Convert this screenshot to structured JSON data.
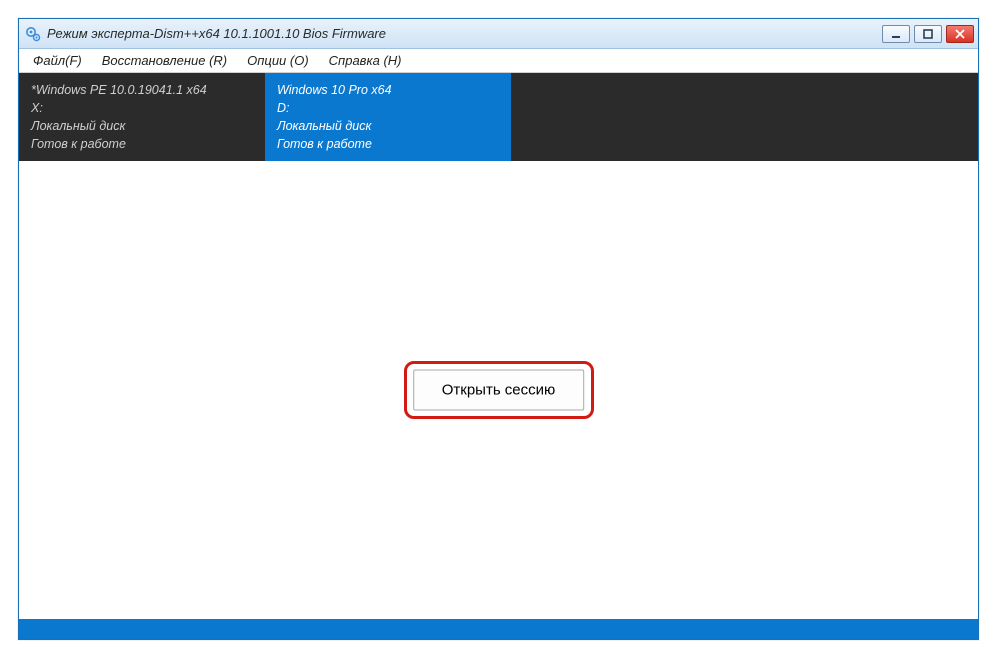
{
  "window": {
    "title": "Режим эксперта-Dism++x64 10.1.1001.10 Bios Firmware"
  },
  "menu": {
    "file": "Файл(F)",
    "restore": "Восстановление (R)",
    "options": "Опции (O)",
    "help": "Справка (H)"
  },
  "images": [
    {
      "title": "*Windows PE 10.0.19041.1 x64",
      "drive": "X:",
      "disk": "Локальный диск",
      "status": "Готов к работе",
      "selected": false
    },
    {
      "title": "Windows 10 Pro x64",
      "drive": "D:",
      "disk": "Локальный диск",
      "status": "Готов к работе",
      "selected": true
    }
  ],
  "main": {
    "open_session": "Открыть сессию"
  }
}
